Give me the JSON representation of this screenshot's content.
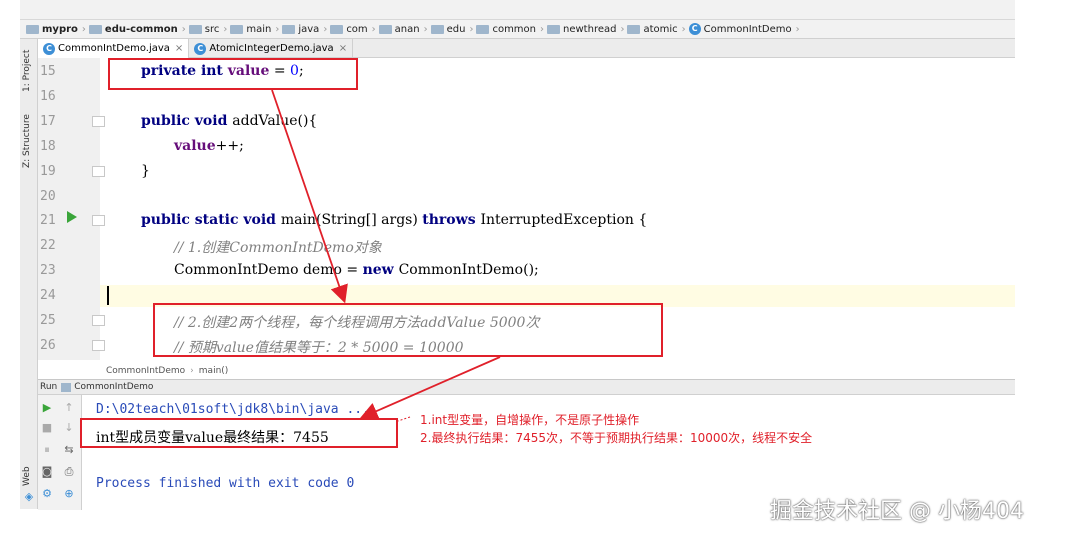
{
  "breadcrumb": {
    "items": [
      {
        "label": "mypro",
        "bold": true
      },
      {
        "label": "edu-common",
        "bold": true
      },
      {
        "label": "src"
      },
      {
        "label": "main"
      },
      {
        "label": "java"
      },
      {
        "label": "com"
      },
      {
        "label": "anan"
      },
      {
        "label": "edu"
      },
      {
        "label": "common"
      },
      {
        "label": "newthread"
      },
      {
        "label": "atomic"
      },
      {
        "label": "CommonIntDemo",
        "class_icon": true
      }
    ]
  },
  "tabs": [
    {
      "label": "CommonIntDemo.java",
      "active": true
    },
    {
      "label": "AtomicIntegerDemo.java",
      "active": false
    }
  ],
  "side_labels": {
    "project": "1: Project",
    "structure": "Z: Structure",
    "web": "Web"
  },
  "editor": {
    "line_numbers": [
      "15",
      "16",
      "17",
      "18",
      "19",
      "20",
      "21",
      "22",
      "23",
      "24",
      "25",
      "26"
    ],
    "lines": {
      "l15": {
        "kw": "private int ",
        "fld": "value",
        "rest": " = ",
        "num": "0",
        "end": ";"
      },
      "l17": {
        "kw": "public ",
        "kw2": "void ",
        "rest": "addValue(){"
      },
      "l18": {
        "fld": "value",
        "rest": "++;"
      },
      "l19": {
        "rest": "}"
      },
      "l21": {
        "kw": "public static void ",
        "rest": "main(String[] args) ",
        "kw2": "throws ",
        "rest2": "InterruptedException {"
      },
      "l22": {
        "cmt": "// 1.创建CommonIntDemo对象"
      },
      "l23": {
        "rest": "CommonIntDemo demo = ",
        "kw": "new ",
        "rest2": "CommonIntDemo();"
      },
      "l25": {
        "cmt": "// 2.创建2两个线程，每个线程调用方法addValue 5000次"
      },
      "l26": {
        "cmt": "// 预期value值结果等于：2 * 5000 = 10000"
      }
    },
    "crumbs": {
      "cls": "CommonIntDemo",
      "method": "main()"
    }
  },
  "run": {
    "label": "Run",
    "config": "CommonIntDemo",
    "output": [
      "D:\\02teach\\01soft\\jdk8\\bin\\java ...",
      "int型成员变量value最终结果：7455",
      "Process finished with exit code 0"
    ]
  },
  "annotations": [
    "1.int型变量，自增操作，不是原子性操作",
    "2.最终执行结果：7455次，不等于预期执行结果：10000次，线程不安全"
  ],
  "watermark": "掘金技术社区 @ 小杨404",
  "colors": {
    "annotation_red": "#e0202a",
    "keyword": "#000080",
    "field": "#660e7a",
    "comment": "#808080",
    "number": "#0000ff"
  }
}
